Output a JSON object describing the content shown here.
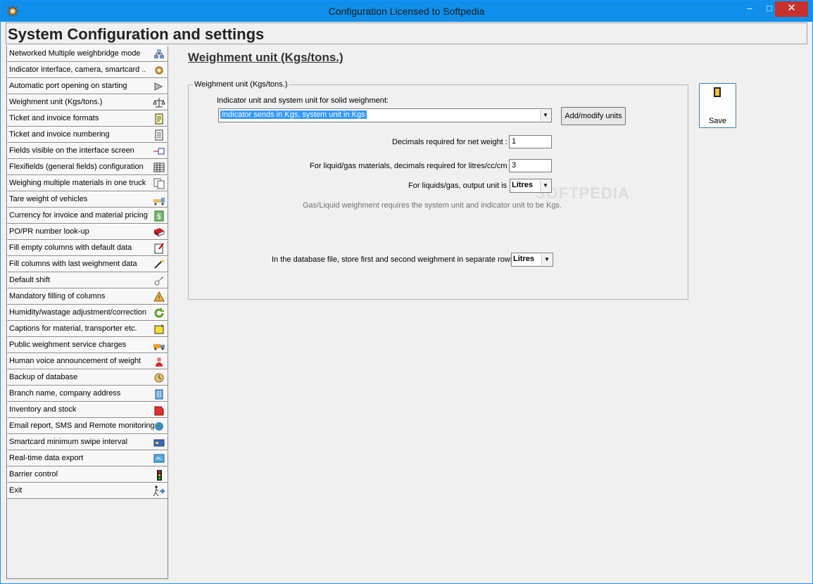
{
  "window": {
    "title": "Configuration  Licensed to Softpedia",
    "minimize": "–",
    "maximize": "□",
    "close": "✕"
  },
  "header": {
    "title": "System Configuration and settings"
  },
  "sidebar": {
    "items": [
      {
        "label": "Networked Multiple weighbridge mode",
        "icon": "network-icon"
      },
      {
        "label": "Indicator interface, camera, smartcard ..",
        "icon": "gear-icon"
      },
      {
        "label": "Automatic port opening on starting",
        "icon": "plug-icon"
      },
      {
        "label": "Weighment unit (Kgs/tons.)",
        "icon": "scale-icon"
      },
      {
        "label": "Ticket and invoice formats",
        "icon": "ticket-icon"
      },
      {
        "label": "Ticket and invoice numbering",
        "icon": "numbering-icon"
      },
      {
        "label": "Fields visible on the interface screen",
        "icon": "fields-icon"
      },
      {
        "label": "Flexifields (general fields) configuration",
        "icon": "grid-icon"
      },
      {
        "label": "Weighing multiple materials in one truck",
        "icon": "documents-icon"
      },
      {
        "label": "Tare weight of vehicles",
        "icon": "truck-icon"
      },
      {
        "label": "Currency for invoice and material pricing",
        "icon": "currency-icon"
      },
      {
        "label": "PO/PR number look-up",
        "icon": "book-icon"
      },
      {
        "label": "Fill empty columns with default data",
        "icon": "edit-icon"
      },
      {
        "label": "Fill columns with last weighment data",
        "icon": "wand-icon"
      },
      {
        "label": "Default shift",
        "icon": "key-icon"
      },
      {
        "label": "Mandatory filling of columns",
        "icon": "warning-icon"
      },
      {
        "label": "Humidity/wastage adjustment/correction",
        "icon": "refresh-icon"
      },
      {
        "label": "Captions for material, transporter etc.",
        "icon": "caption-icon"
      },
      {
        "label": "Public weighment service charges",
        "icon": "delivery-truck-icon"
      },
      {
        "label": "Human voice announcement of weight",
        "icon": "person-icon"
      },
      {
        "label": "Backup of database",
        "icon": "backup-icon"
      },
      {
        "label": "Branch name, company address",
        "icon": "building-icon"
      },
      {
        "label": "Inventory and stock",
        "icon": "inventory-icon"
      },
      {
        "label": "Email report, SMS and Remote monitoring",
        "icon": "globe-icon"
      },
      {
        "label": "Smartcard minimum swipe interval",
        "icon": "smartcard-icon"
      },
      {
        "label": "Real-time data export",
        "icon": "export-icon"
      },
      {
        "label": "Barrier control",
        "icon": "traffic-light-icon"
      },
      {
        "label": "Exit",
        "icon": "exit-icon"
      }
    ]
  },
  "main": {
    "section_title": "Weighment unit (Kgs/tons.)",
    "group_title": "Weighment unit (Kgs/tons.)",
    "unit_label": "Indicator unit and system unit for solid weighment:",
    "unit_value": "Indicator sends in Kgs, system unit in Kgs",
    "add_modify_label": "Add/modify units",
    "net_decimals_label": "Decimals required for net weight :",
    "net_decimals_value": "1",
    "liquid_decimals_label": "For liquid/gas materials, decimals required for litres/cc/cm :",
    "liquid_decimals_value": "3",
    "output_unit_label": "For liquids/gas, output unit is",
    "output_unit_value": "Litres",
    "note": "Gas/Liquid weighment requires the system unit and indicator unit to be Kgs.",
    "db_rows_label": "In the database file, store first and second weighment in separate rows",
    "db_rows_value": "Litres",
    "save_label": "Save"
  },
  "watermark": "SOFTPEDIA",
  "colors": {
    "titlebar": "#0f8fea",
    "close_button": "#c7312b",
    "selection": "#3399ff",
    "background": "#f0f0f0"
  }
}
